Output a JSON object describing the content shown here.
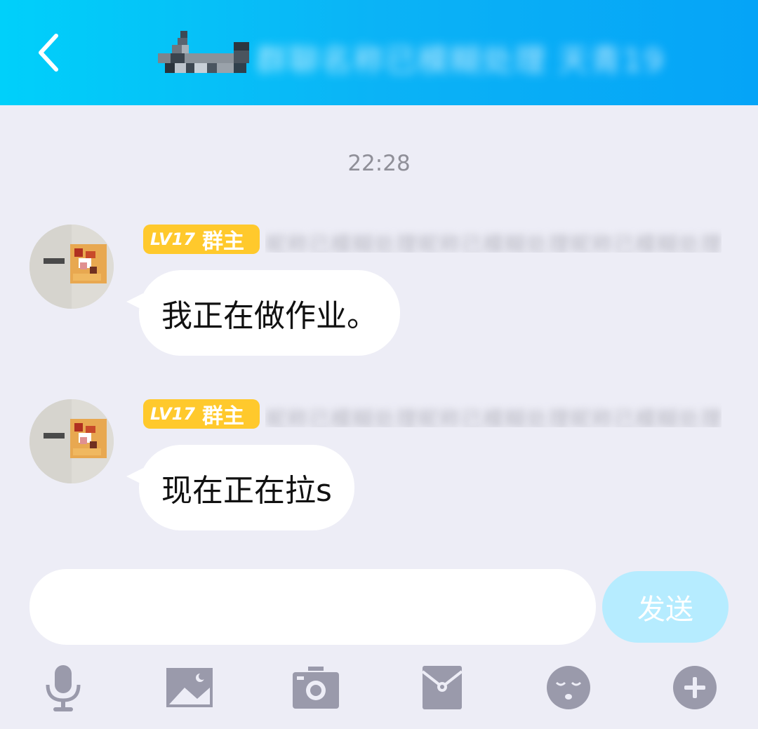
{
  "header": {
    "title": "群聊名称已模糊处理 天青19",
    "back_icon": "chevron-left-icon",
    "gradient": [
      "#00d0fa",
      "#05a4f7"
    ]
  },
  "chat": {
    "timestamp": "22:28",
    "messages": [
      {
        "level_badge": "LV17",
        "role": "群主",
        "sender_name": "昵称已模糊处理昵称已模糊处理昵称已模糊处理",
        "text": "我正在做作业。"
      },
      {
        "level_badge": "LV17",
        "role": "群主",
        "sender_name": "昵称已模糊处理昵称已模糊处理昵称已模糊处理",
        "text": "现在正在拉s"
      }
    ]
  },
  "composer": {
    "input_value": "",
    "send_label": "发送"
  },
  "toolbar": {
    "items": [
      "microphone-icon",
      "image-icon",
      "camera-icon",
      "red-packet-icon",
      "emoji-icon",
      "plus-icon"
    ]
  },
  "colors": {
    "background": "#ededf6",
    "badge": "#ffc92c",
    "send_button": "#b6ecff",
    "icon_gray": "#9a9aab"
  }
}
